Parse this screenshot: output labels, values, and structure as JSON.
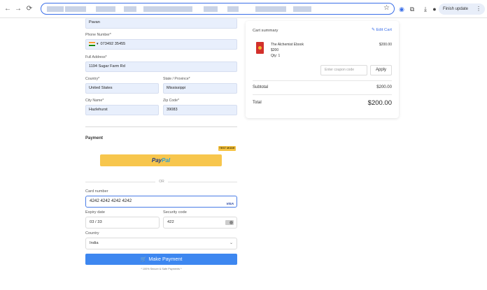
{
  "browser": {
    "back": "←",
    "forward": "→",
    "reload": "⟳",
    "star": "☆",
    "finish_update": "Finish update",
    "menu_dots": "⋮"
  },
  "form": {
    "name_value": "Pavan",
    "phone_label": "Phone Number*",
    "phone_code": "▾",
    "phone_value": "073492 35455",
    "address_label": "Full Address*",
    "address_value": "1194 Sugar Farm Rd",
    "country_label": "Country*",
    "country_value": "United States",
    "state_label": "State / Province*",
    "state_value": "Mississippi",
    "city_label": "City Name*",
    "city_value": "Hazlehurst",
    "zip_label": "Zip Code*",
    "zip_value": "39083"
  },
  "payment": {
    "title": "Payment",
    "test_mode": "TEST MODE",
    "paypal_part1": "Pay",
    "paypal_part2": "Pal",
    "or_text": "OR",
    "card_number_label": "Card number",
    "card_number_value": "4242 4242 4242 4242",
    "card_brand": "VISA",
    "expiry_label": "Expiry date",
    "expiry_value": "03 / 33",
    "security_label": "Security code",
    "security_value": "422",
    "country_label": "Country",
    "country_value": "India",
    "chevron": "⌄",
    "pay_button": "Make Payment",
    "cart_glyph": "🛒",
    "secure_text": "* 100% Secure & Safe Payments *"
  },
  "cart": {
    "title": "Cart summary",
    "edit_label": "Edit Cart",
    "item_name": "The Alchemist Ebook",
    "item_unit_price": "$200",
    "item_qty": "Qty: 1",
    "item_price": "$200.00",
    "coupon_placeholder": "Enter coupon code",
    "apply_label": "Apply",
    "subtotal_label": "Subtotal",
    "subtotal_value": "$200.00",
    "total_label": "Total",
    "total_value": "$200.00"
  },
  "colors": {
    "accent": "#3d87f0",
    "paypal_yellow": "#f7c64d",
    "field_bg": "#e8effc",
    "test_badge": "#f6c343"
  }
}
